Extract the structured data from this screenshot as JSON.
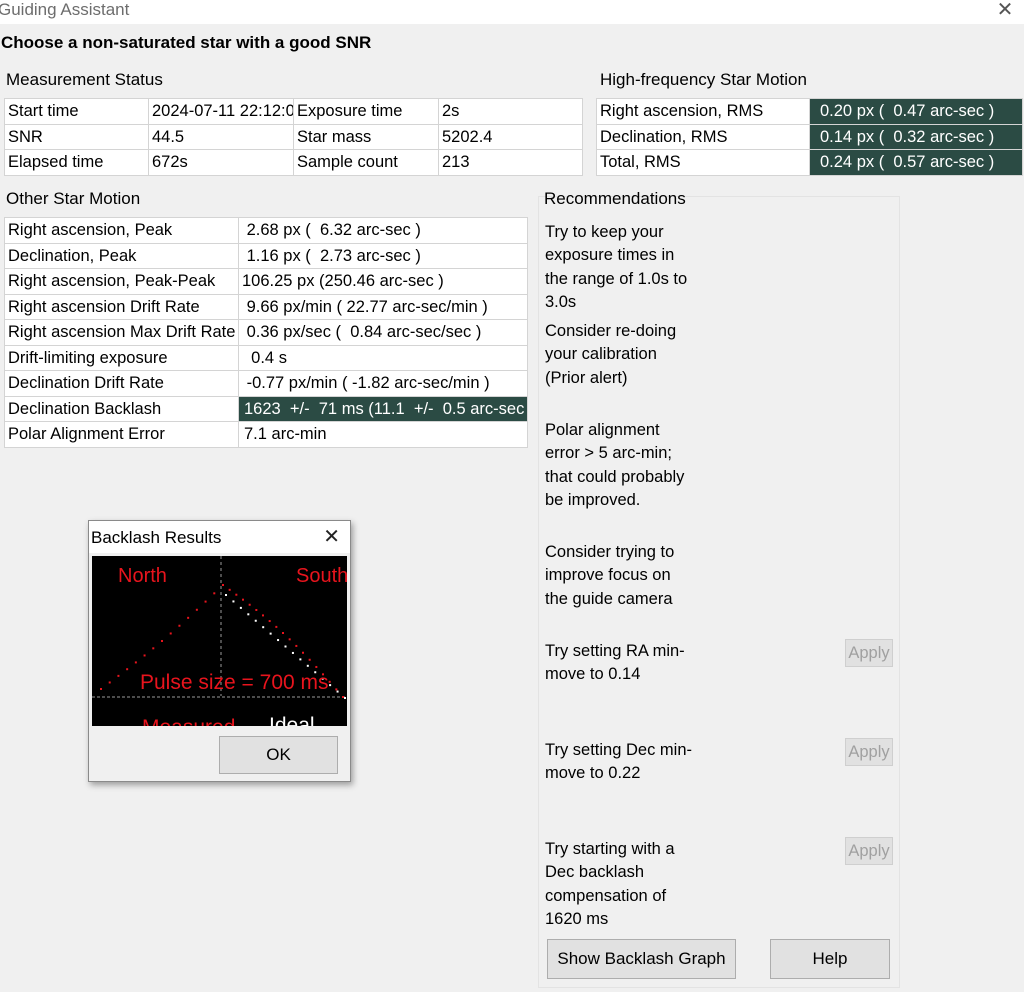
{
  "window": {
    "title": "Guiding Assistant",
    "close_glyph": "✕"
  },
  "heading": "Choose a non-saturated star with a good SNR",
  "measurement": {
    "label": "Measurement Status",
    "rows": [
      [
        "Start time",
        "2024-07-11 22:12:0",
        "Exposure time",
        "2s"
      ],
      [
        "SNR",
        "44.5",
        "Star mass",
        "5202.4"
      ],
      [
        "Elapsed time",
        "672s",
        "Sample count",
        "213"
      ]
    ]
  },
  "highfreq": {
    "label": "High-frequency Star Motion",
    "rows": [
      [
        "Right ascension, RMS",
        "0.20 px (  0.47 arc-sec )"
      ],
      [
        "Declination, RMS",
        "0.14 px (  0.32 arc-sec )"
      ],
      [
        "Total, RMS",
        "0.24 px (  0.57 arc-sec )"
      ]
    ]
  },
  "other": {
    "label": "Other Star Motion",
    "rows": [
      [
        "Right ascension, Peak",
        " 2.68 px (  6.32 arc-sec )"
      ],
      [
        "Declination, Peak",
        " 1.16 px (  2.73 arc-sec )"
      ],
      [
        "Right ascension, Peak-Peak",
        "106.25 px (250.46 arc-sec )"
      ],
      [
        "Right ascension Drift Rate",
        " 9.66 px/min ( 22.77 arc-sec/min )"
      ],
      [
        "Right ascension Max Drift Rate",
        " 0.36 px/sec (  0.84 arc-sec/sec )"
      ],
      [
        "Drift-limiting exposure",
        "  0.4 s"
      ],
      [
        "Declination Drift Rate",
        " -0.77 px/min ( -1.82 arc-sec/min )"
      ],
      [
        "Declination Backlash",
        "1623  +/-  71 ms (11.1  +/-  0.5 arc-sec"
      ],
      [
        "Polar Alignment Error",
        "7.1 arc-min"
      ]
    ]
  },
  "recommendations": {
    "label": "Recommendations",
    "items": [
      {
        "text": "Try to keep your exposure times in the range of 1.0s to 3.0s"
      },
      {
        "text": "Consider re-doing your calibration (Prior alert)"
      },
      {
        "text": "Polar alignment error > 5 arc-min; that could probably be improved."
      },
      {
        "text": "Consider trying to improve focus on the guide camera"
      },
      {
        "text": "Try setting RA min-move to 0.14",
        "apply_label": "Apply"
      },
      {
        "text": "Try setting Dec min-move to 0.22",
        "apply_label": "Apply"
      },
      {
        "text": "Try starting with a Dec backlash compensation of 1620 ms",
        "apply_label": "Apply"
      }
    ]
  },
  "buttons": {
    "show_backlash": "Show Backlash Graph",
    "help": "Help"
  },
  "backlash_dialog": {
    "title": "Backlash Results",
    "close_glyph": "✕",
    "ok_label": "OK",
    "plot": {
      "north_label": "North",
      "south_label": "South",
      "pulse_label": "Pulse size = 700 ms",
      "measured_label": "Measured",
      "ideal_label": "Ideal",
      "colors": {
        "background": "#000000",
        "measured": "#e8141d",
        "ideal": "#ffffff"
      }
    }
  }
}
